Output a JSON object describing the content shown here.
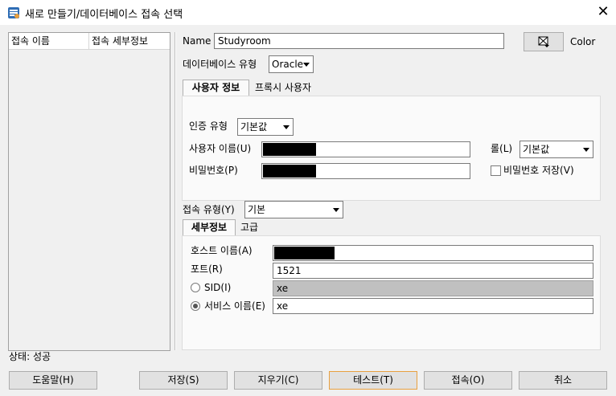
{
  "window": {
    "title": "새로 만들기/데이터베이스 접속 선택",
    "close_glyph": "✕"
  },
  "list": {
    "col_name": "접속 이름",
    "col_detail": "접속 세부정보"
  },
  "form": {
    "name_label": "Name",
    "name_value": "Studyroom",
    "color_label": "Color",
    "db_type_label": "데이터베이스 유형",
    "db_type_value": "Oracle",
    "tab_user": "사용자 정보",
    "tab_proxy": "프록시 사용자",
    "auth_type_label": "인증 유형",
    "auth_type_value": "기본값",
    "username_label": "사용자 이름(U)",
    "role_label": "롤(L)",
    "role_value": "기본값",
    "password_label": "비밀번호(P)",
    "save_password_label": "비밀번호 저장(V)",
    "conn_type_label": "접속 유형(Y)",
    "conn_type_value": "기본",
    "tab_details": "세부정보",
    "tab_advanced": "고급",
    "host_label": "호스트 이름(A)",
    "port_label": "포트(R)",
    "port_value": "1521",
    "sid_label": "SID(I)",
    "sid_value": "xe",
    "service_label": "서비스 이름(E)",
    "service_value": "xe",
    "selected_radio": "service"
  },
  "status": {
    "text": "상태: 성공"
  },
  "buttons": {
    "help": "도움말(H)",
    "save": "저장(S)",
    "clear": "지우기(C)",
    "test": "테스트(T)",
    "connect": "접속(O)",
    "cancel": "취소"
  },
  "icons": {
    "app": "sql-developer-icon",
    "color_picker": "color-picker-icon"
  },
  "colors": {
    "focus_border": "#e8a040",
    "disabled_field": "#c0c0c0",
    "redaction": "#000000"
  }
}
